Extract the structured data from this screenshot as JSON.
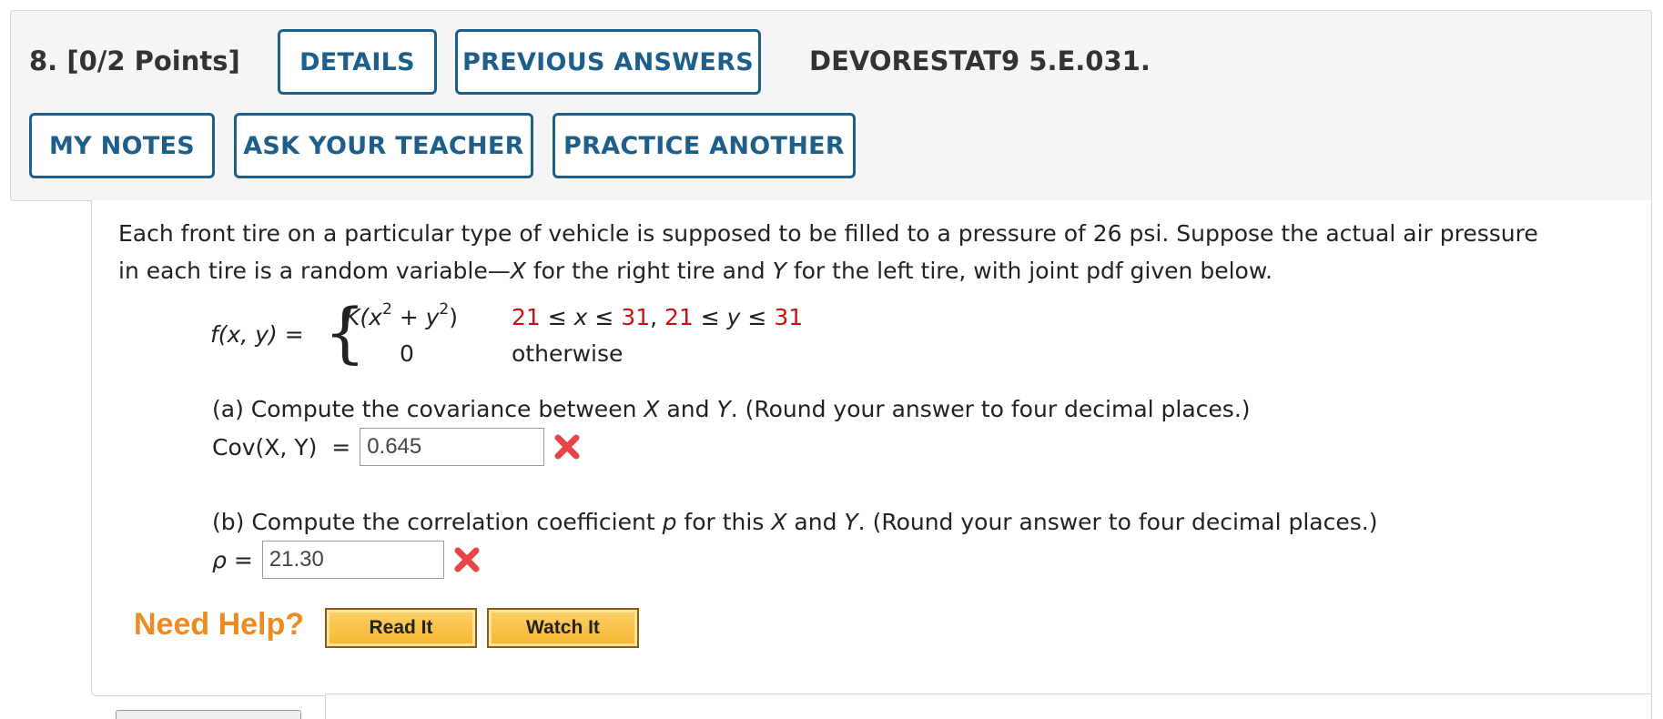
{
  "header": {
    "question_number": "8.",
    "points": "[0/2 Points]",
    "details_label": "DETAILS",
    "previous_answers_label": "PREVIOUS ANSWERS",
    "question_code": "DEVORESTAT9 5.E.031.",
    "my_notes_label": "MY NOTES",
    "ask_teacher_label": "ASK YOUR TEACHER",
    "practice_another_label": "PRACTICE ANOTHER"
  },
  "question": {
    "line1": "Each front tire on a particular type of vehicle is supposed to be filled to a pressure of 26 psi. Suppose the actual air pressure",
    "line2_pre": "in each tire is a random variable—",
    "var_x": "X",
    "line2_mid1": " for the right tire and ",
    "var_y": "Y",
    "line2_mid2": " for the left tire, with joint pdf given below."
  },
  "formula": {
    "lhs": "f(x, y) =",
    "case1_expr_pre": "K(x",
    "case1_exp1": "2",
    "case1_expr_mid": " + y",
    "case1_exp2": "2",
    "case1_expr_post": ")",
    "case0_expr": "0",
    "cond_lo_x": "21",
    "cond_x_mid": " ≤ x ≤ ",
    "cond_hi_x": "31",
    "cond_sep": ", ",
    "cond_lo_y": "21",
    "cond_y_mid": " ≤ y ≤ ",
    "cond_hi_y": "31",
    "otherwise": "otherwise"
  },
  "part_a": {
    "prompt_pre": "(a) Compute the covariance between ",
    "var_x": "X",
    "prompt_and": " and ",
    "var_y": "Y",
    "prompt_post": ". (Round your answer to four decimal places.)",
    "label": "Cov(X, Y)  =",
    "answer": "0.645",
    "status": "incorrect"
  },
  "part_b": {
    "prompt_pre": "(b) Compute the correlation coefficient ",
    "var_p": "p",
    "prompt_mid": " for this ",
    "var_x": "X",
    "prompt_and": " and ",
    "var_y": "Y",
    "prompt_post": ". (Round your answer to four decimal places.)",
    "label": "ρ =",
    "answer": "21.30",
    "status": "incorrect"
  },
  "help": {
    "need_help_label": "Need Help?",
    "read_it_label": "Read It",
    "watch_it_label": "Watch It"
  },
  "colors": {
    "button_border": "#1d5f8a",
    "condition_red": "#cc1111",
    "need_help_orange": "#ee8a1e",
    "wrong_mark": "#e64646"
  }
}
